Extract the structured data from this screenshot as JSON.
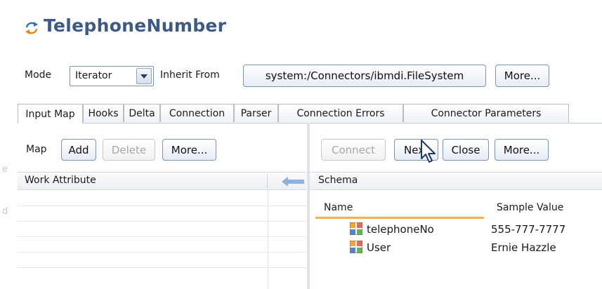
{
  "title": "TelephoneNumber",
  "mode_row": {
    "mode_label": "Mode",
    "mode_value": "Iterator",
    "inherit_label": "Inherit From",
    "inherit_value": "system:/Connectors/ibmdi.FileSystem",
    "more_label": "More..."
  },
  "tabs": [
    {
      "label": "Input Map",
      "active": true
    },
    {
      "label": "Hooks"
    },
    {
      "label": "Delta"
    },
    {
      "label": "Connection"
    },
    {
      "label": "Parser"
    },
    {
      "label": "Connection Errors"
    },
    {
      "label": "Connector Parameters"
    }
  ],
  "left": {
    "map_label": "Map",
    "add_label": "Add",
    "delete_label": "Delete",
    "more_label": "More...",
    "column_header": "Work Attribute"
  },
  "right": {
    "connect_label": "Connect",
    "next_label": "Next",
    "close_label": "Close",
    "more_label": "More...",
    "schema_label": "Schema",
    "columns": {
      "name": "Name",
      "sample": "Sample Value"
    },
    "rows": [
      {
        "name": "telephoneNo",
        "sample": "555-777-7777"
      },
      {
        "name": "User",
        "sample": "Ernie Hazzle"
      }
    ]
  },
  "colors": {
    "title": "#3f5a82",
    "button_border": "#7a93b8",
    "arrow": "#8fb0dc",
    "column_underline": "#f1b34a"
  },
  "icons": [
    "refresh-icon",
    "dropdown-arrow-icon",
    "left-arrow-icon",
    "attribute-icon",
    "mouse-cursor-icon"
  ]
}
